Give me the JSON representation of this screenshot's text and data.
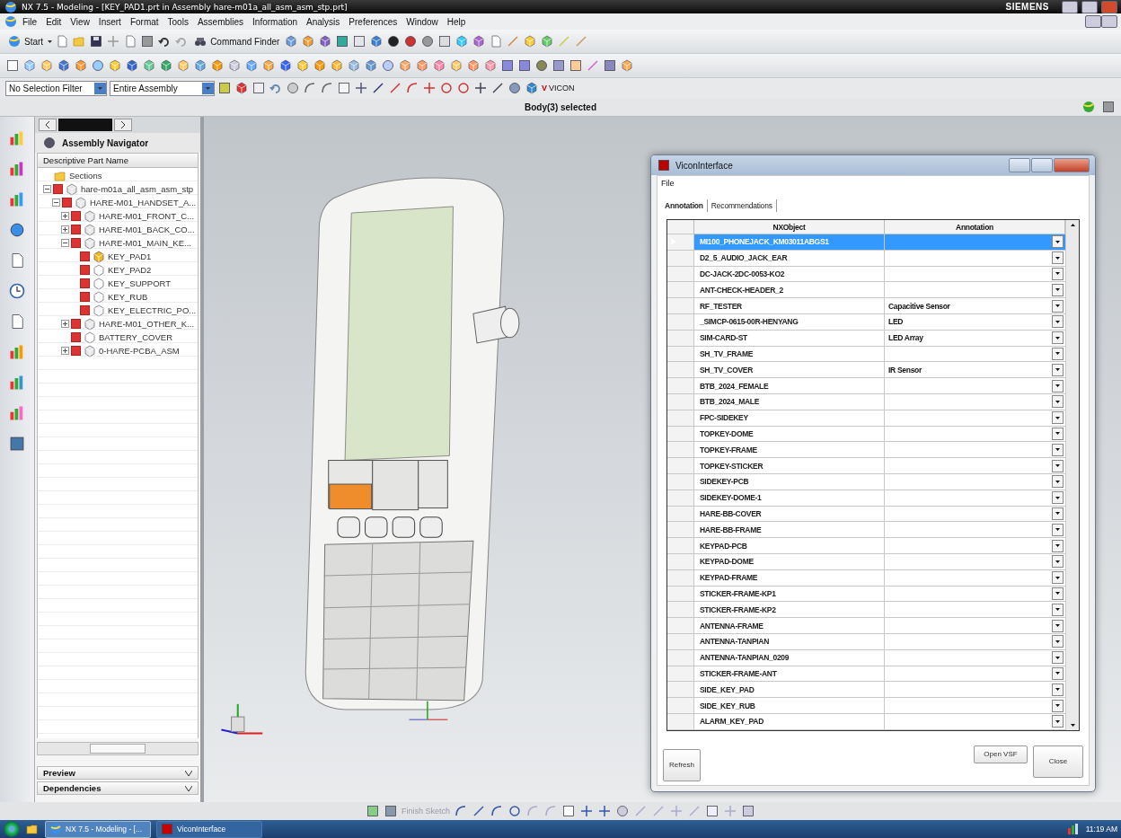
{
  "window": {
    "title": "NX 7.5 - Modeling - [KEY_PAD1.prt in Assembly hare-m01a_all_asm_asm_stp.prt]",
    "brand": "SIEMENS"
  },
  "menu": [
    "File",
    "Edit",
    "View",
    "Insert",
    "Format",
    "Tools",
    "Assemblies",
    "Information",
    "Analysis",
    "Preferences",
    "Window",
    "Help"
  ],
  "toolbar": {
    "start": "Start",
    "command_finder": "Command Finder"
  },
  "selection_bar": {
    "filter": "No Selection Filter",
    "scope": "Entire Assembly",
    "vicon_mark": "V",
    "vicon": "VICON"
  },
  "status": "Body(3) selected",
  "navigator": {
    "title": "Assembly Navigator",
    "column": "Descriptive Part Name",
    "tree": [
      {
        "label": "Sections",
        "kind": "folder"
      },
      {
        "label": "hare-m01a_all_asm_asm_stp",
        "kind": "assembly",
        "checked": true,
        "expanded": true,
        "children": [
          {
            "label": "HARE-M01_HANDSET_A...",
            "kind": "assembly",
            "checked": true,
            "expanded": true,
            "children": [
              {
                "label": "HARE-M01_FRONT_C...",
                "kind": "assembly",
                "checked": true,
                "expanded": false
              },
              {
                "label": "HARE-M01_BACK_CO...",
                "kind": "assembly",
                "checked": true,
                "expanded": false
              },
              {
                "label": "HARE-M01_MAIN_KE...",
                "kind": "assembly",
                "checked": true,
                "expanded": true,
                "children": [
                  {
                    "label": "KEY_PAD1",
                    "kind": "work-part",
                    "checked": true
                  },
                  {
                    "label": "KEY_PAD2",
                    "kind": "part",
                    "checked": true
                  },
                  {
                    "label": "KEY_SUPPORT",
                    "kind": "part",
                    "checked": true
                  },
                  {
                    "label": "KEY_RUB",
                    "kind": "part",
                    "checked": true
                  },
                  {
                    "label": "KEY_ELECTRIC_PO...",
                    "kind": "part",
                    "checked": true
                  }
                ]
              },
              {
                "label": "HARE-M01_OTHER_K...",
                "kind": "assembly",
                "checked": true,
                "expanded": false
              },
              {
                "label": "BATTERY_COVER",
                "kind": "part",
                "checked": true
              },
              {
                "label": "0-HARE-PCBA_ASM",
                "kind": "assembly",
                "checked": true,
                "expanded": false
              }
            ]
          }
        ]
      }
    ],
    "panels": [
      "Preview",
      "Dependencies"
    ]
  },
  "dialog": {
    "title": "ViconInterface",
    "menu": [
      "File"
    ],
    "tabs": [
      {
        "label": "Annotation",
        "selected": true
      },
      {
        "label": "Recommendations",
        "selected": false
      }
    ],
    "columns": [
      "NXObject",
      "Annotation"
    ],
    "rows": [
      {
        "nx_object": "MI100_PHONEJACK_KM03011ABGS1",
        "selected": true
      },
      {
        "nx_object": "D2_5_AUDIO_JACK_EAR",
        "selected": false
      },
      {
        "nx_object": "DC-JACK-2DC-0053-KO2",
        "selected": false
      },
      {
        "nx_object": "ANT-CHECK-HEADER_2",
        "selected": false
      },
      {
        "nx_object": "RF_TESTER",
        "annotation": "Capacitive Sensor",
        "selected": false
      },
      {
        "nx_object": "_SIMCP-0615-00R-HENYANG",
        "annotation": "LED",
        "selected": false
      },
      {
        "nx_object": "SIM-CARD-ST",
        "annotation": "LED Array",
        "selected": false
      },
      {
        "nx_object": "SH_TV_FRAME",
        "selected": false
      },
      {
        "nx_object": "SH_TV_COVER",
        "annotation": "IR Sensor",
        "selected": false
      },
      {
        "nx_object": "BTB_2024_FEMALE",
        "selected": false
      },
      {
        "nx_object": "BTB_2024_MALE",
        "selected": false
      },
      {
        "nx_object": "FPC-SIDEKEY",
        "selected": false
      },
      {
        "nx_object": "TOPKEY-DOME",
        "selected": false
      },
      {
        "nx_object": "TOPKEY-FRAME",
        "selected": false
      },
      {
        "nx_object": "TOPKEY-STICKER",
        "selected": false
      },
      {
        "nx_object": "SIDEKEY-PCB",
        "selected": false
      },
      {
        "nx_object": "SIDEKEY-DOME-1",
        "selected": false
      },
      {
        "nx_object": "HARE-BB-COVER",
        "selected": false
      },
      {
        "nx_object": "HARE-BB-FRAME",
        "selected": false
      },
      {
        "nx_object": "KEYPAD-PCB",
        "selected": false
      },
      {
        "nx_object": "KEYPAD-DOME",
        "selected": false
      },
      {
        "nx_object": "KEYPAD-FRAME",
        "selected": false
      },
      {
        "nx_object": "STICKER-FRAME-KP1",
        "selected": false
      },
      {
        "nx_object": "STICKER-FRAME-KP2",
        "selected": false
      },
      {
        "nx_object": "ANTENNA-FRAME",
        "selected": false
      },
      {
        "nx_object": "ANTENNA-TANPIAN",
        "selected": false
      },
      {
        "nx_object": "ANTENNA-TANPIAN_0209",
        "selected": false
      },
      {
        "nx_object": "STICKER-FRAME-ANT",
        "selected": false
      },
      {
        "nx_object": "SIDE_KEY_PAD",
        "selected": false
      },
      {
        "nx_object": "SIDE_KEY_RUB",
        "selected": false
      },
      {
        "nx_object": "ALARM_KEY_PAD",
        "selected": false
      }
    ],
    "buttons": [
      "Refresh",
      "Open VSF",
      "Close"
    ]
  },
  "sketch_toolbar": {
    "finish": "Finish Sketch"
  },
  "taskbar": {
    "tasks": [
      {
        "label": "NX 7.5 - Modeling - [...",
        "selected": true
      },
      {
        "label": "ViconInterface",
        "selected": false
      }
    ],
    "clock": "11:19 AM"
  }
}
